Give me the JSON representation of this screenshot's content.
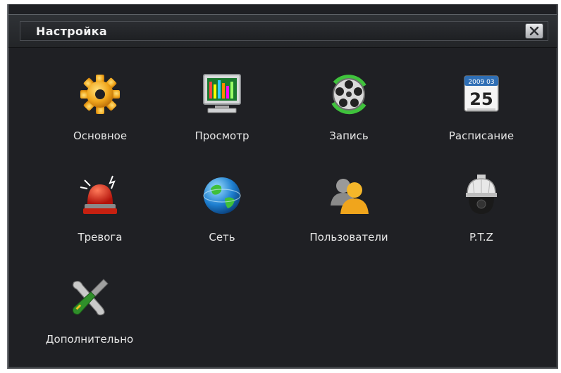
{
  "window": {
    "title": "Настройка"
  },
  "menu": {
    "items": [
      {
        "id": "basic",
        "label": "Основное",
        "icon": "gear-icon"
      },
      {
        "id": "live",
        "label": "Просмотр",
        "icon": "monitor-icon"
      },
      {
        "id": "record",
        "label": "Запись",
        "icon": "film-reel-icon"
      },
      {
        "id": "schedule",
        "label": "Расписание",
        "icon": "calendar-icon"
      },
      {
        "id": "alarm",
        "label": "Тревога",
        "icon": "siren-icon"
      },
      {
        "id": "network",
        "label": "Сеть",
        "icon": "globe-icon"
      },
      {
        "id": "users",
        "label": "Пользователи",
        "icon": "users-icon"
      },
      {
        "id": "ptz",
        "label": "P.T.Z",
        "icon": "dome-camera-icon"
      },
      {
        "id": "advanced",
        "label": "Дополнительно",
        "icon": "tools-icon"
      }
    ]
  },
  "calendar": {
    "date_top": "2009 03",
    "day": "25"
  },
  "colors": {
    "background": "#1f2024",
    "text": "#e6e6e6",
    "title_text": "#f2f2f2"
  }
}
